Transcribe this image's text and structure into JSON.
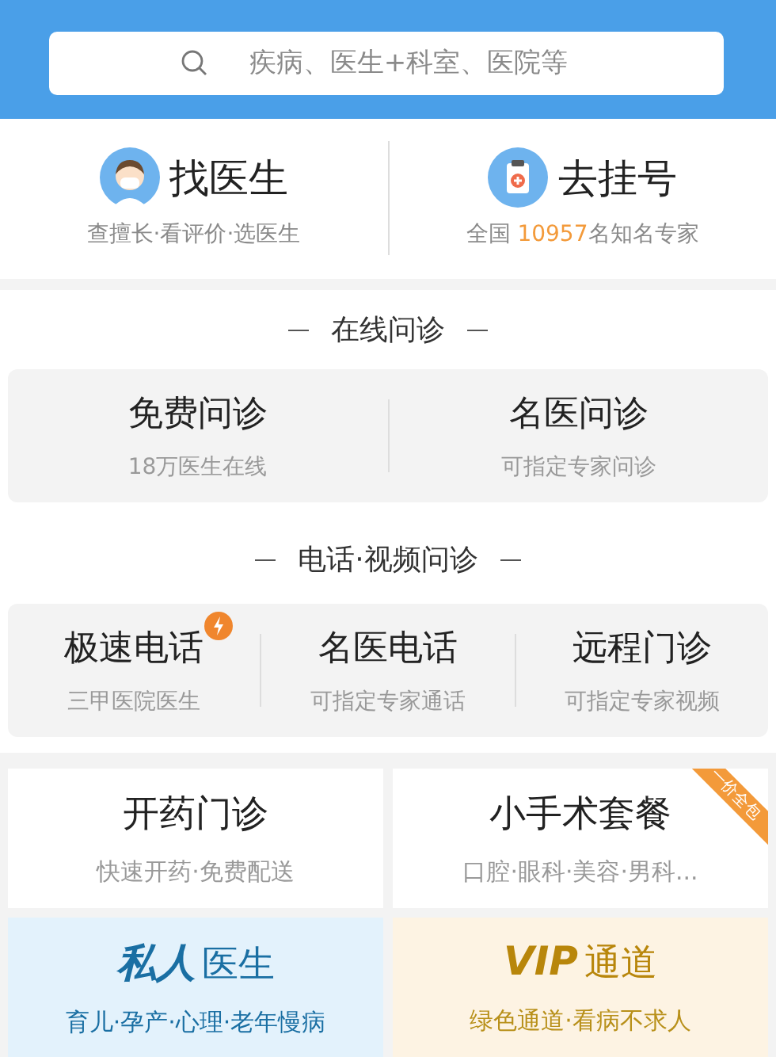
{
  "search": {
    "placeholder": "疾病、医生+科室、医院等"
  },
  "entries": [
    {
      "kind": "doctor",
      "title": "找医生",
      "subtitle_parts": [
        "查擅长·看评价·选医生"
      ]
    },
    {
      "kind": "register",
      "title": "去挂号",
      "subtitle_parts": [
        "全国 ",
        "10957",
        "名知名专家"
      ]
    }
  ],
  "sections": [
    {
      "title": "在线问诊",
      "items": [
        {
          "title": "免费问诊",
          "subtitle": "18万医生在线",
          "badge": false
        },
        {
          "title": "名医问诊",
          "subtitle": "可指定专家问诊",
          "badge": false
        }
      ]
    },
    {
      "title": "电话·视频问诊",
      "items": [
        {
          "title": "极速电话",
          "subtitle": "三甲医院医生",
          "badge": true
        },
        {
          "title": "名医电话",
          "subtitle": "可指定专家通话",
          "badge": false
        },
        {
          "title": "远程门诊",
          "subtitle": "可指定专家视频",
          "badge": false
        }
      ]
    }
  ],
  "tiles": [
    {
      "kind": "plain",
      "title": "开药门诊",
      "subtitle": "快速开药·免费配送"
    },
    {
      "kind": "plain",
      "title": "小手术套餐",
      "subtitle": "口腔·眼科·美容·男科...",
      "ribbon": "一价全包"
    },
    {
      "kind": "private",
      "brand": "私人",
      "title": "医生",
      "subtitle": "育儿·孕产·心理·老年慢病"
    },
    {
      "kind": "vip",
      "brand": "VIP",
      "title": "通道",
      "subtitle": "绿色通道·看病不求人"
    }
  ]
}
